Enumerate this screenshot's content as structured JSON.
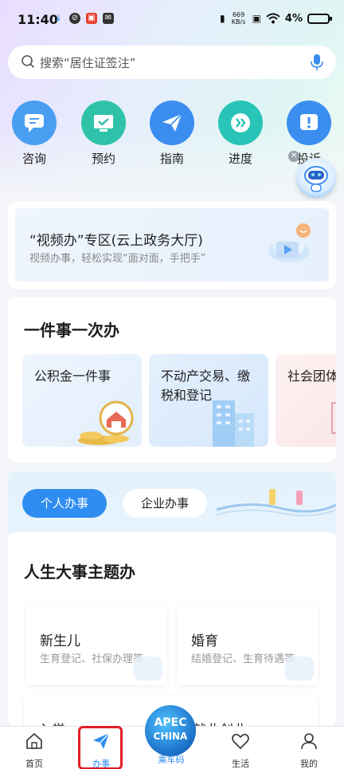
{
  "status_bar": {
    "time": "11:40",
    "net_speed_value": "669",
    "net_speed_unit": "KB/s",
    "battery": "4%"
  },
  "search": {
    "placeholder": "搜索“居住证签注”"
  },
  "quick_actions": [
    {
      "label": "咨询",
      "icon": "chat-icon",
      "color": "#4a9ef2"
    },
    {
      "label": "预约",
      "icon": "calendar-check-icon",
      "color": "#2ec3a8"
    },
    {
      "label": "指南",
      "icon": "paper-plane-icon",
      "color": "#3b8ef0"
    },
    {
      "label": "进度",
      "icon": "double-chevron-icon",
      "color": "#27c4b7"
    },
    {
      "label": "投诉",
      "icon": "alert-icon",
      "color": "#3b8ef0"
    }
  ],
  "video_banner": {
    "title": "“视频办”专区(云上政务大厅)",
    "subtitle": "视频办事，轻松实现“面对面，手把手”"
  },
  "one_thing": {
    "title": "一件事一次办",
    "tiles": [
      {
        "label": "公积金一件事"
      },
      {
        "label": "不动产交易、缴税和登记"
      },
      {
        "label": "社会团体"
      }
    ]
  },
  "tabs": {
    "personal": "个人办事",
    "company": "企业办事"
  },
  "life_events": {
    "title": "人生大事主题办",
    "items": [
      {
        "name": "新生儿",
        "desc": "生育登记、社保办理等"
      },
      {
        "name": "婚育",
        "desc": "结婚登记、生育待遇等"
      }
    ],
    "partial_item_fragments": [
      "入学",
      "就业创业"
    ]
  },
  "bottom_nav": {
    "items": [
      {
        "label": "首页",
        "icon": "home-icon"
      },
      {
        "label": "办事",
        "icon": "send-icon"
      },
      {
        "label": "乘车码",
        "icon": "apec-logo"
      },
      {
        "label": "生活",
        "icon": "heart-icon"
      },
      {
        "label": "我的",
        "icon": "user-icon"
      }
    ],
    "apec_line1": "APEC",
    "apec_line2": "CHINA"
  },
  "colors": {
    "accent": "#2f8cf0",
    "highlight": "#e21e26"
  }
}
